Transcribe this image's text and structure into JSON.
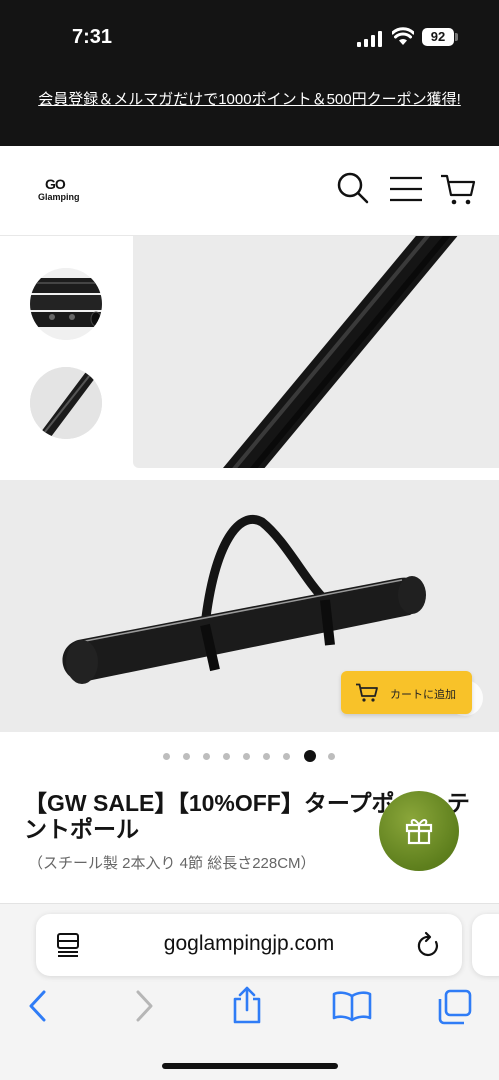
{
  "status_bar": {
    "time": "7:31",
    "battery": "92"
  },
  "announcement": {
    "text": "会員登録＆メルマガだけで1000ポイント＆500円クーポン獲得!"
  },
  "header": {
    "logo_top": "GO",
    "logo_bottom": "Glamping"
  },
  "gallery": {
    "active_dot": 7,
    "dot_count": 9
  },
  "cart_button": {
    "label": "カートに追加"
  },
  "product": {
    "title": "【GW SALE】【10%OFF】タープポール テントポール",
    "subtitle": "（スチール製 2本入り 4節 総長さ228CM）"
  },
  "safari": {
    "url": "goglampingjp.com"
  },
  "colors": {
    "accent": "#f8c229",
    "gift": "#5e7f1d",
    "safari_blue": "#2f7cf6",
    "dark": "#141414"
  }
}
